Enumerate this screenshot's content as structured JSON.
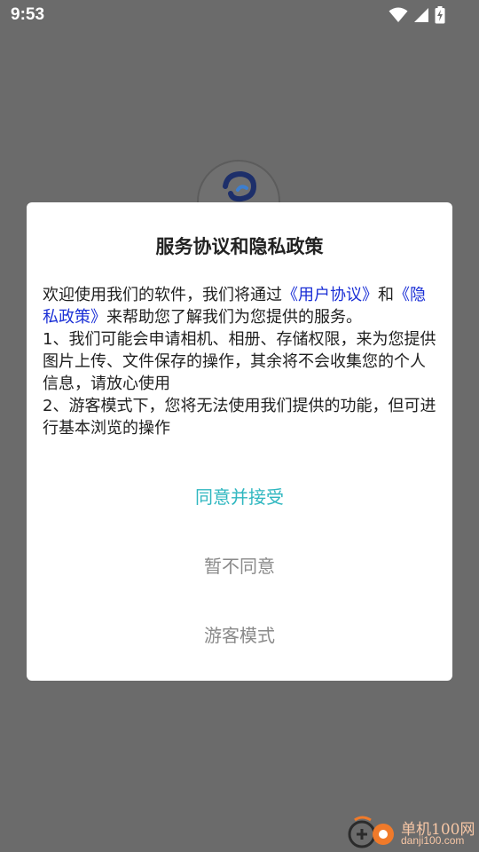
{
  "status_bar": {
    "time": "9:53",
    "icons": [
      "wifi-icon",
      "signal-icon",
      "battery-charging-icon"
    ]
  },
  "app": {
    "logo_icon": "app-logo-icon"
  },
  "dialog": {
    "title": "服务协议和隐私政策",
    "body": {
      "intro_prefix": "欢迎使用我们的软件，我们将通过",
      "user_agreement_link": "《用户协议》",
      "connector": "和",
      "privacy_policy_link": "《隐私政策》",
      "intro_suffix": "来帮助您了解我们为您提供的服务。",
      "item1": "1、我们可能会申请相机、相册、存储权限，来为您提供图片上传、文件保存的操作，其余将不会收集您的个人信息，请放心使用",
      "item2": "2、游客模式下，您将无法使用我们提供的功能，但可进行基本浏览的操作"
    },
    "buttons": {
      "accept": "同意并接受",
      "decline": "暂不同意",
      "guest": "游客模式"
    }
  },
  "watermark": {
    "name": "单机100网",
    "url": "danji100.com"
  },
  "colors": {
    "overlay": "#6b6b6b",
    "accent": "#2fb7c0",
    "link": "#1a2fd6",
    "secondary_button": "#8a8a8a"
  }
}
